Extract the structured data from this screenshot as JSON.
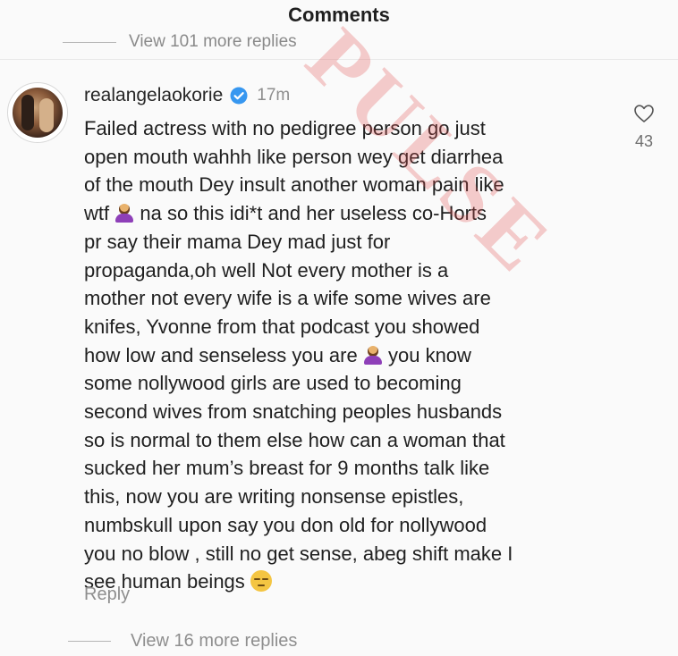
{
  "header": {
    "title": "Comments"
  },
  "thread": {
    "previous_replies": "View 101 more replies",
    "more_replies": "View 16 more replies"
  },
  "comment": {
    "username": "realangelaokorie",
    "verified": true,
    "time": "17m",
    "likes": "43",
    "reply_label": "Reply",
    "lines": [
      "Failed actress with no pedigree person go just",
      "open mouth wahhh like person wey get diarrhea",
      "of the mouth Dey insult another woman pain like",
      "wtf",
      "na so this idi*t  and her useless co-Horts",
      "pr say their mama Dey mad just for",
      "propaganda,oh well Not every mother is a",
      "mother not every wife is a wife some wives are",
      "knifes, Yvonne from that podcast you showed",
      "how low and senseless you are",
      "you know",
      "some nollywood girls are used to becoming",
      "second wives from snatching peoples husbands",
      "so is normal to them else how can a woman that",
      "sucked her mum’s breast for 9 months talk like",
      "this, now you are writing nonsense epistles,",
      "numbskull upon say you don old for nollywood",
      "you no blow , still no get sense, abeg shift make I",
      "see human beings"
    ],
    "emojis": [
      "woman-shrugging-emoji",
      "unamused-face-emoji"
    ]
  },
  "watermark": {
    "text": "PULSE"
  },
  "colors": {
    "text": "#202020",
    "muted": "#8e8e8e",
    "verified_blue": "#3797f0",
    "watermark": "#e15050"
  }
}
